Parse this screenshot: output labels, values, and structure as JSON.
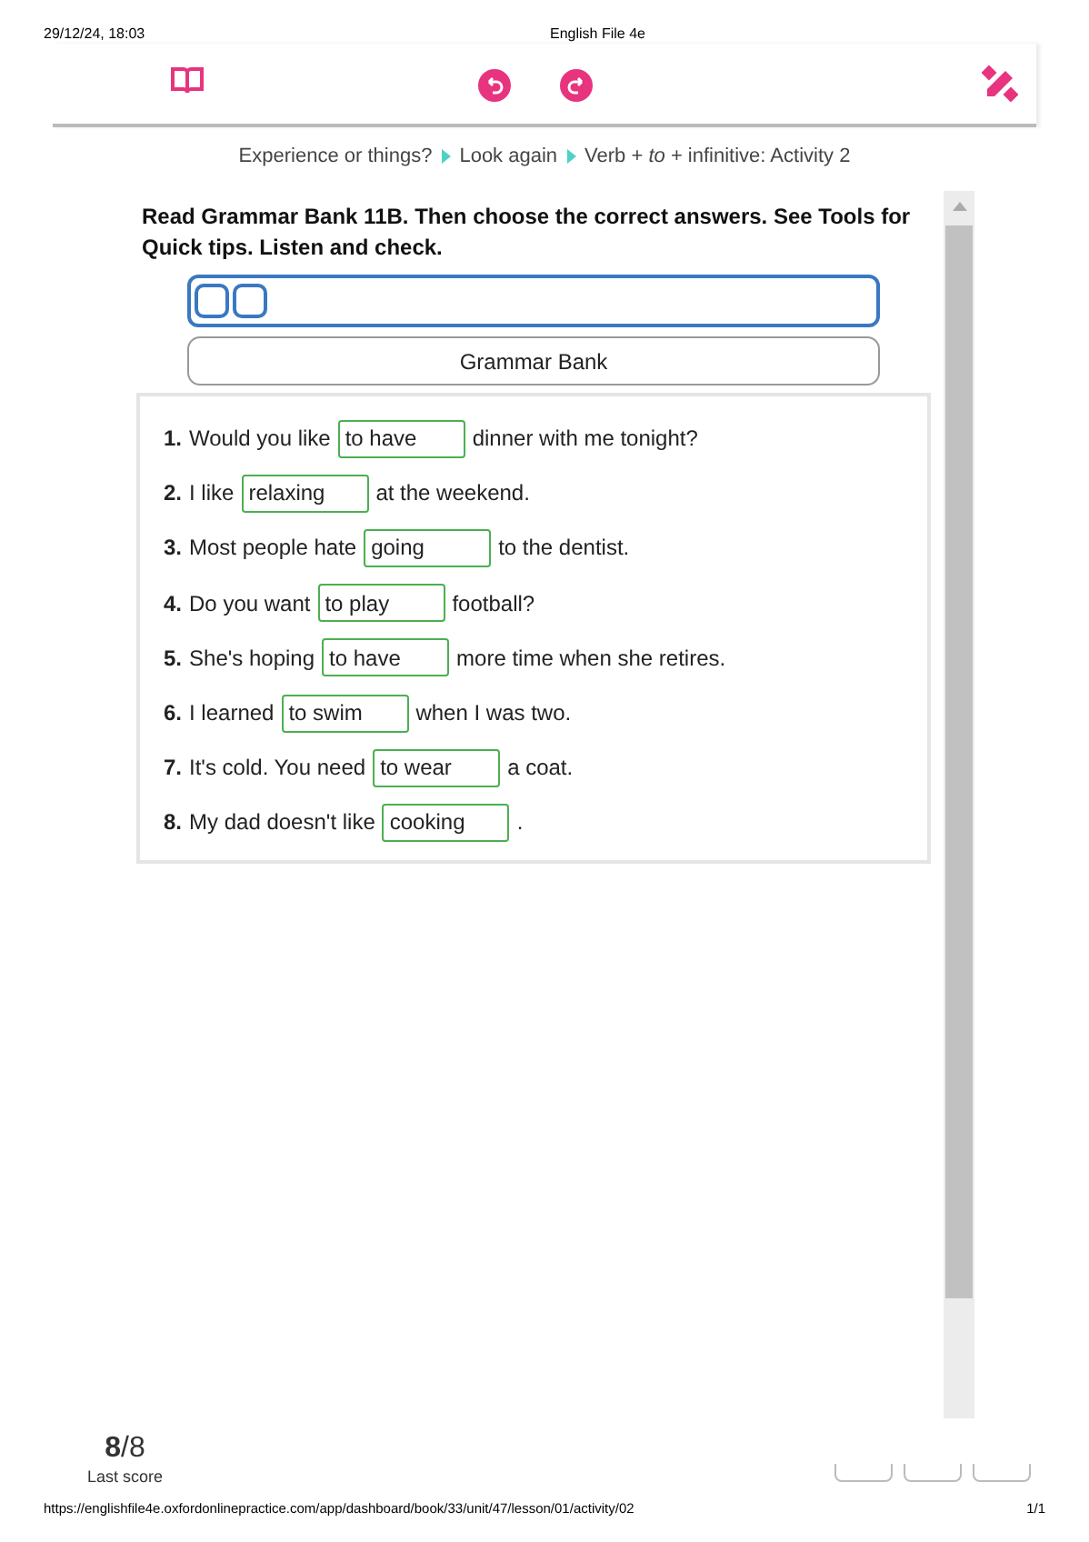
{
  "print_header": {
    "date": "29/12/24, 18:03",
    "title": "English File 4e"
  },
  "breadcrumb": [
    {
      "text": "Experience or things?"
    },
    {
      "text": "Look again"
    },
    {
      "text": "Verb + *to* + infinitive: Activity 2"
    }
  ],
  "instructions": "Read Grammar Bank 11B. Then choose the correct answers. See Tools for Quick tips. Listen and check.",
  "grammar_bank_button": "Grammar Bank",
  "questions": [
    {
      "number": "1.",
      "before": "Would you like",
      "answer": "to have",
      "after": "dinner with me tonight?",
      "correct": true
    },
    {
      "number": "2.",
      "before": "I like",
      "answer": "relaxing",
      "after": "at the weekend.",
      "correct": true
    },
    {
      "number": "3.",
      "before": "Most people hate",
      "answer": "going",
      "after": "to the dentist.",
      "correct": true
    },
    {
      "number": "4.",
      "before": "Do you want",
      "answer": "to play",
      "after": "football?",
      "correct": true
    },
    {
      "number": "5.",
      "before": "She's hoping",
      "answer": "to have",
      "after": "more time when she retires.",
      "correct": true
    },
    {
      "number": "6.",
      "before": "I learned",
      "answer": "to swim",
      "after": "when I was two.",
      "correct": true
    },
    {
      "number": "7.",
      "before": "It's cold. You need",
      "answer": "to wear",
      "after": "a coat.",
      "correct": true
    },
    {
      "number": "8.",
      "before": "My dad doesn't like",
      "answer": "cooking",
      "after": ".",
      "correct": true
    }
  ],
  "score": {
    "value": "8",
    "total": "/8",
    "label": "Last score"
  },
  "print_footer": {
    "url": "https://englishfile4e.oxfordonlinepractice.com/app/dashboard/book/33/unit/47/lesson/01/activity/02",
    "page": "1/1"
  }
}
